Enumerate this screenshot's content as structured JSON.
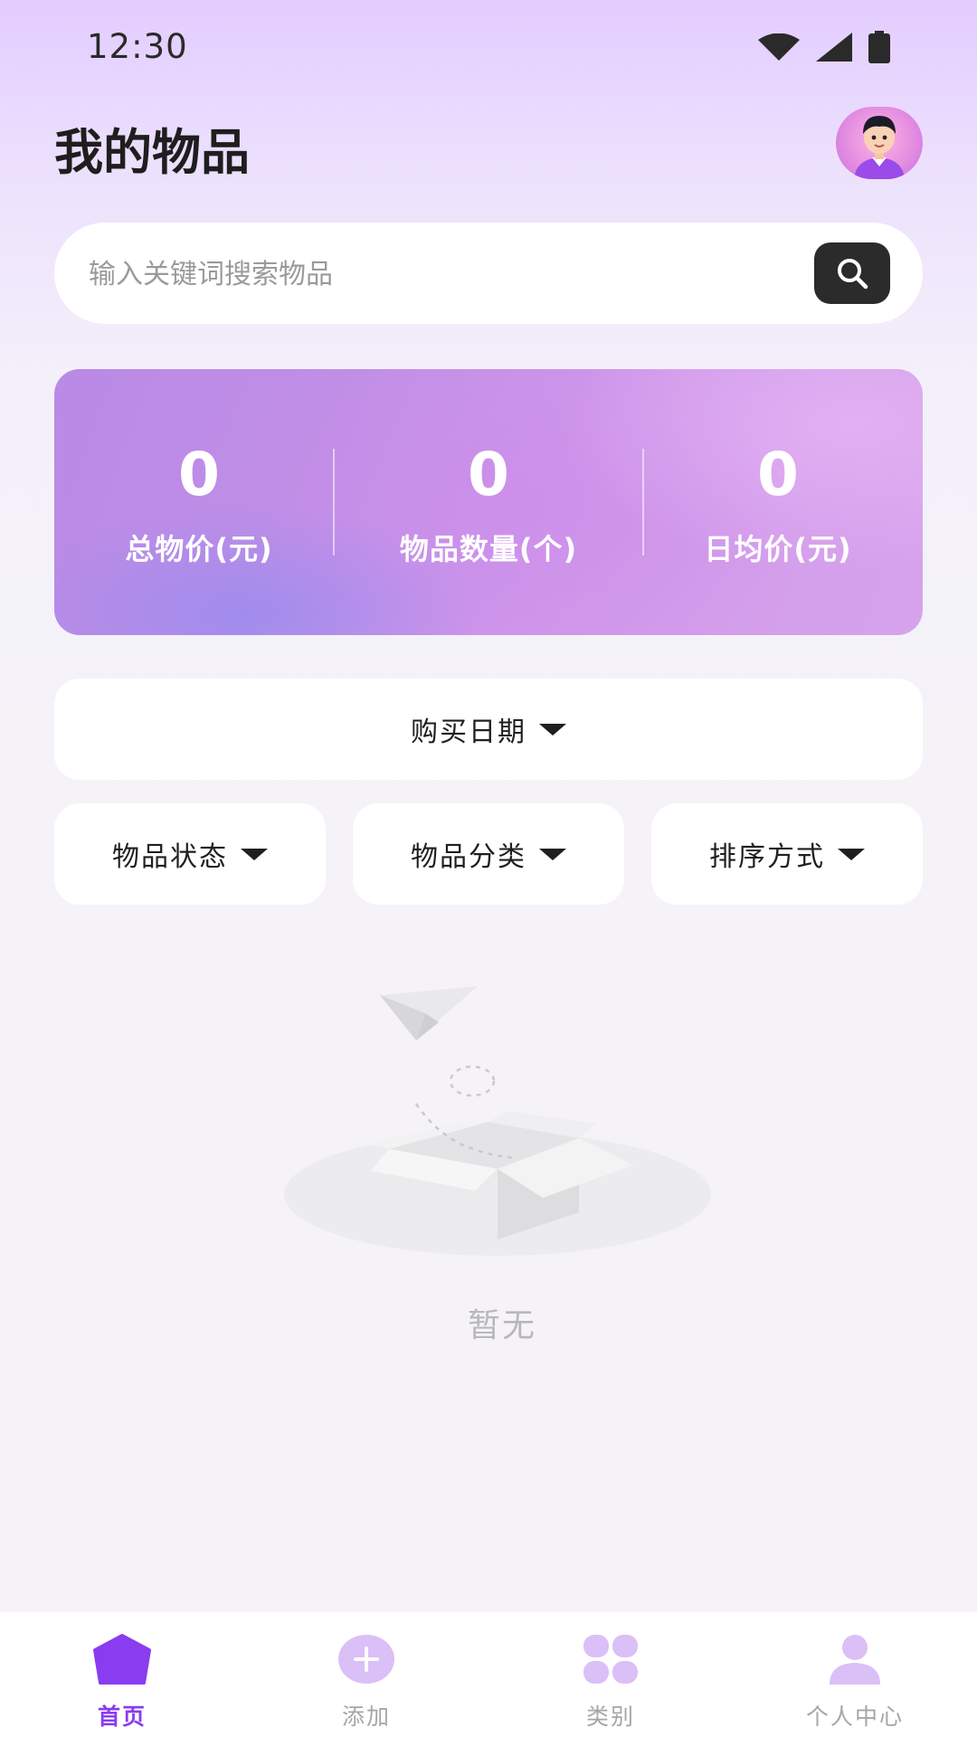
{
  "status_bar": {
    "time": "12:30"
  },
  "header": {
    "title": "我的物品"
  },
  "search": {
    "placeholder": "输入关键词搜索物品"
  },
  "stats": [
    {
      "value": "0",
      "label": "总物价(元)"
    },
    {
      "value": "0",
      "label": "物品数量(个)"
    },
    {
      "value": "0",
      "label": "日均价(元)"
    }
  ],
  "filters": {
    "purchase_date": "购买日期",
    "status": "物品状态",
    "category": "物品分类",
    "sort": "排序方式"
  },
  "empty_state": {
    "text": "暂无"
  },
  "bottom_nav": [
    {
      "label": "首页",
      "icon": "home-icon",
      "active": true
    },
    {
      "label": "添加",
      "icon": "add-icon",
      "active": false
    },
    {
      "label": "类别",
      "icon": "category-icon",
      "active": false
    },
    {
      "label": "个人中心",
      "icon": "profile-icon",
      "active": false
    }
  ],
  "colors": {
    "accent": "#8a3cf0",
    "stats_card": "#c495e8",
    "search_button": "#2b2b2b"
  }
}
